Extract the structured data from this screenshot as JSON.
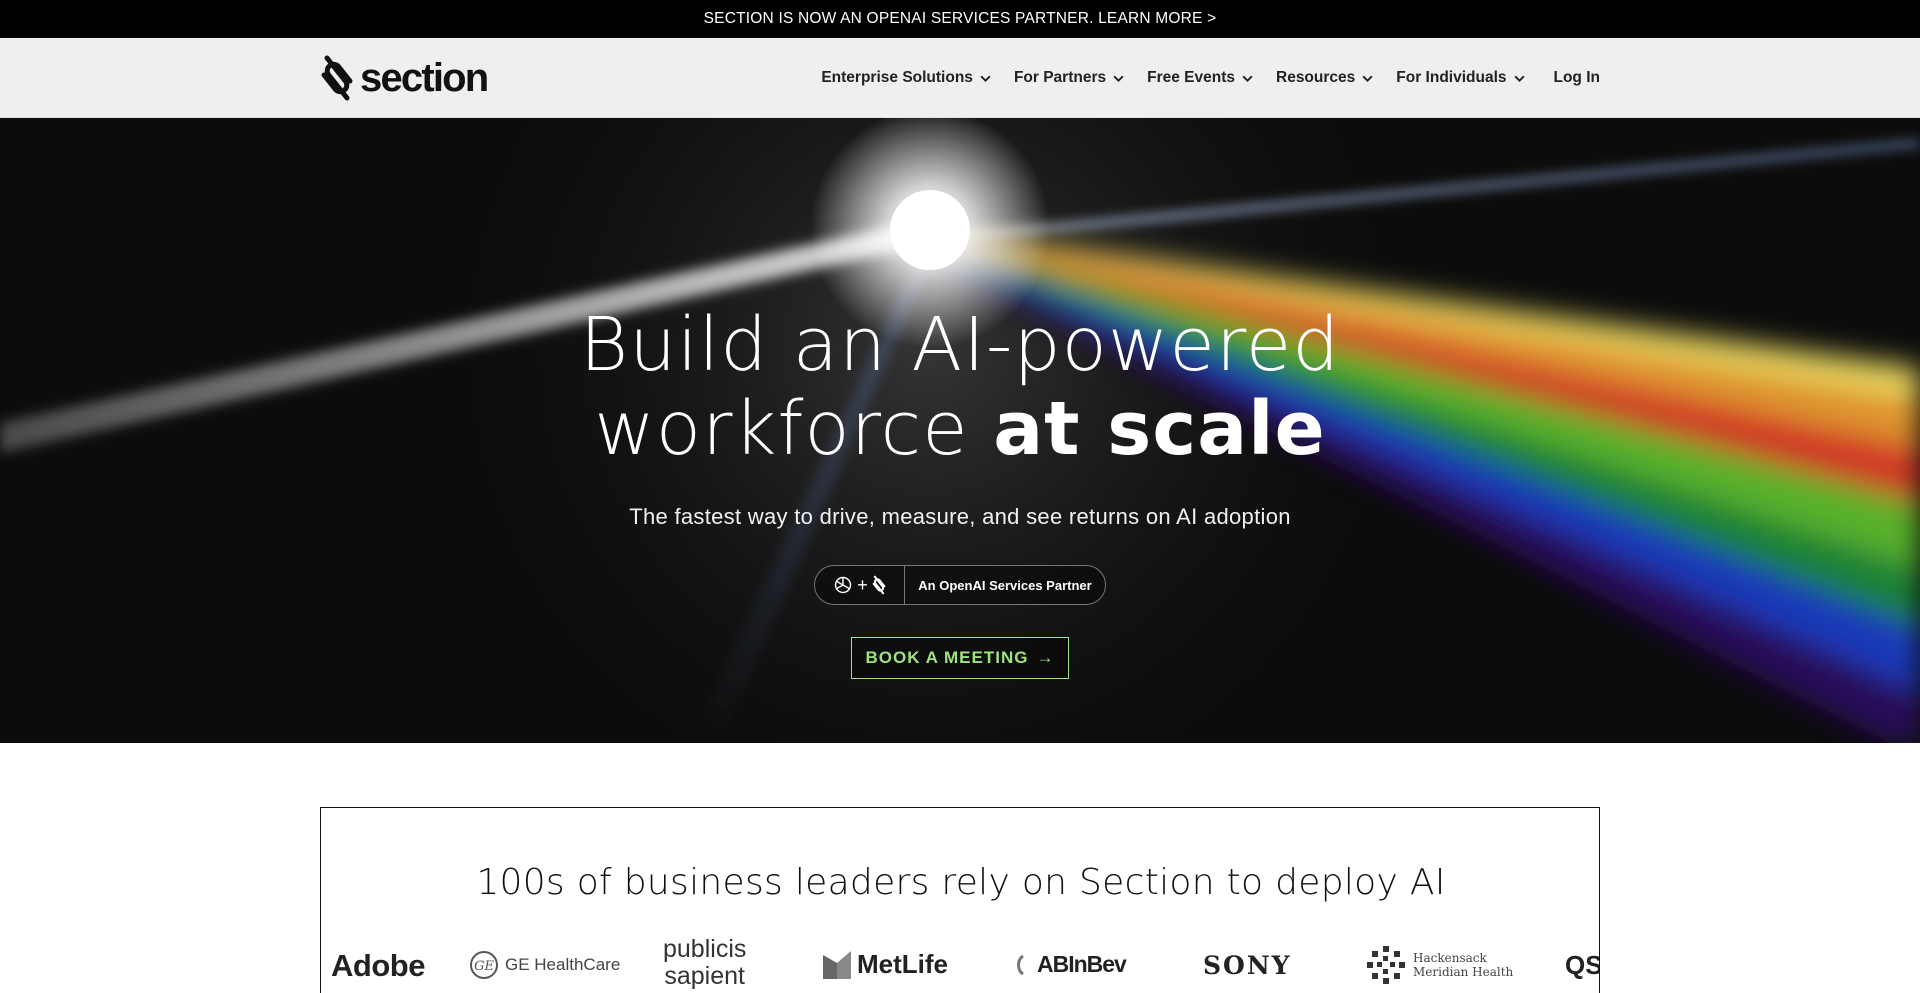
{
  "announcement": {
    "text": "SECTION IS NOW AN OPENAI SERVICES PARTNER. LEARN MORE >"
  },
  "header": {
    "logo_text": "section",
    "logo_icon": "section-paperclip-icon",
    "nav": [
      {
        "label": "Enterprise Solutions",
        "has_dropdown": true
      },
      {
        "label": "For Partners",
        "has_dropdown": true
      },
      {
        "label": "Free Events",
        "has_dropdown": true
      },
      {
        "label": "Resources",
        "has_dropdown": true
      },
      {
        "label": "For Individuals",
        "has_dropdown": true
      }
    ],
    "login_label": "Log In"
  },
  "hero": {
    "title_line1": "Build an AI-powered",
    "title_line2_regular": "workforce",
    "title_line2_bold": "at scale",
    "subtitle": "The fastest way to drive, measure, and see returns on AI adoption",
    "partner_badge": {
      "plus": "+",
      "text": "An OpenAI Services Partner",
      "icons": [
        "openai-logo-icon",
        "section-paperclip-icon"
      ]
    },
    "cta_label": "BOOK A MEETING",
    "cta_arrow": "→",
    "colors": {
      "cta": "#9ee37d",
      "background": "#0c0c0c"
    }
  },
  "clients": {
    "title": "100s of business leaders rely on Section to deploy AI",
    "logos": [
      {
        "name": "Adobe"
      },
      {
        "name": "GE HealthCare"
      },
      {
        "name": "publicis",
        "name2": "sapient"
      },
      {
        "name": "MetLife"
      },
      {
        "name": "ABInBev"
      },
      {
        "name": "SONY"
      },
      {
        "name": "Hackensack",
        "name2": "Meridian Health"
      },
      {
        "name": "QS"
      }
    ]
  }
}
